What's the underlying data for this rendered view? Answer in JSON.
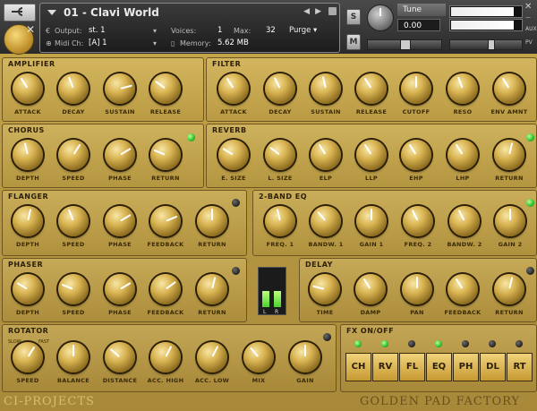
{
  "header": {
    "instrument_name": "01 - Clavi World",
    "output_label": "Output:",
    "output_value": "st. 1",
    "voices_label": "Voices:",
    "voices_value": "1",
    "max_label": "Max:",
    "max_value": "32",
    "purge_label": "Purge",
    "midi_label": "Midi Ch:",
    "midi_value": "[A]  1",
    "memory_label": "Memory:",
    "memory_value": "5.62 MB",
    "solo_label": "S",
    "mute_label": "M",
    "tune_label": "Tune",
    "tune_value": "0.00",
    "aux_label": "AUX",
    "pv_label": "PV",
    "level_fraction": 0.9,
    "pan_center": 0.5,
    "volume_fraction": 0.55
  },
  "sections": {
    "amplifier": {
      "title": "AMPLIFIER",
      "knobs": [
        {
          "label": "ATTACK",
          "value": 0.38
        },
        {
          "label": "DECAY",
          "value": 0.42
        },
        {
          "label": "SUSTAIN",
          "value": 0.78
        },
        {
          "label": "RELEASE",
          "value": 0.3
        }
      ]
    },
    "filter": {
      "title": "FILTER",
      "knobs": [
        {
          "label": "ATTACK",
          "value": 0.38
        },
        {
          "label": "DECAY",
          "value": 0.4
        },
        {
          "label": "SUSTAIN",
          "value": 0.45
        },
        {
          "label": "RELEASE",
          "value": 0.38
        },
        {
          "label": "CUTOFF",
          "value": 0.5
        },
        {
          "label": "RESO",
          "value": 0.42
        },
        {
          "label": "ENV AMNT",
          "value": 0.38
        }
      ]
    },
    "chorus": {
      "title": "CHORUS",
      "knobs": [
        {
          "label": "DEPTH",
          "value": 0.45
        },
        {
          "label": "SPEED",
          "value": 0.62
        },
        {
          "label": "PHASE",
          "value": 0.72
        },
        {
          "label": "RETURN",
          "value": 0.25
        }
      ]
    },
    "reverb": {
      "title": "REVERB",
      "knobs": [
        {
          "label": "E. SIZE",
          "value": 0.28
        },
        {
          "label": "L. SIZE",
          "value": 0.3
        },
        {
          "label": "ELP",
          "value": 0.38
        },
        {
          "label": "LLP",
          "value": 0.38
        },
        {
          "label": "EHP",
          "value": 0.38
        },
        {
          "label": "LHP",
          "value": 0.38
        },
        {
          "label": "RETURN",
          "value": 0.55
        }
      ]
    },
    "flanger": {
      "title": "FLANGER",
      "knobs": [
        {
          "label": "DEPTH",
          "value": 0.55
        },
        {
          "label": "SPEED",
          "value": 0.42
        },
        {
          "label": "PHASE",
          "value": 0.72
        },
        {
          "label": "FEEDBACK",
          "value": 0.75
        },
        {
          "label": "RETURN",
          "value": 0.5
        }
      ]
    },
    "eq": {
      "title": "2-BAND EQ",
      "knobs": [
        {
          "label": "FREQ. 1",
          "value": 0.45
        },
        {
          "label": "BANDW. 1",
          "value": 0.35
        },
        {
          "label": "GAIN 1",
          "value": 0.5
        },
        {
          "label": "FREQ. 2",
          "value": 0.4
        },
        {
          "label": "BANDW. 2",
          "value": 0.4
        },
        {
          "label": "GAIN 2",
          "value": 0.5
        }
      ]
    },
    "phaser": {
      "title": "PHASER",
      "knobs": [
        {
          "label": "DEPTH",
          "value": 0.28
        },
        {
          "label": "SPEED",
          "value": 0.25
        },
        {
          "label": "PHASE",
          "value": 0.72
        },
        {
          "label": "FEEDBACK",
          "value": 0.7
        },
        {
          "label": "RETURN",
          "value": 0.55
        }
      ]
    },
    "delay": {
      "title": "DELAY",
      "knobs": [
        {
          "label": "TIME",
          "value": 0.22
        },
        {
          "label": "DAMP",
          "value": 0.38
        },
        {
          "label": "PAN",
          "value": 0.5
        },
        {
          "label": "FEEDBACK",
          "value": 0.38
        },
        {
          "label": "RETURN",
          "value": 0.55
        }
      ]
    },
    "rotator": {
      "title": "ROTATOR",
      "slow_label": "SLOW",
      "fast_label": "FAST",
      "knobs": [
        {
          "label": "SPEED",
          "value": 0.62
        },
        {
          "label": "BALANCE",
          "value": 0.5
        },
        {
          "label": "DISTANCE",
          "value": 0.32
        },
        {
          "label": "ACC. HIGH",
          "value": 0.6
        },
        {
          "label": "ACC. LOW",
          "value": 0.6
        },
        {
          "label": "MIX",
          "value": 0.35
        },
        {
          "label": "GAIN",
          "value": 0.5
        }
      ]
    }
  },
  "fx_onoff": {
    "title": "FX ON/OFF",
    "buttons": [
      {
        "label": "CH",
        "on": true
      },
      {
        "label": "RV",
        "on": true
      },
      {
        "label": "FL",
        "on": false
      },
      {
        "label": "EQ",
        "on": true
      },
      {
        "label": "PH",
        "on": false
      },
      {
        "label": "DL",
        "on": false
      },
      {
        "label": "RT",
        "on": false
      }
    ]
  },
  "vu": {
    "left_label": "L",
    "right_label": "R",
    "left_level": 0.42,
    "right_level": 0.42
  },
  "footer": {
    "left": "CI-PROJECTS",
    "right": "GOLDEN PAD FACTORY"
  },
  "colors": {
    "gold": "#c9a94c",
    "led_on": "#2cc12a",
    "header": "#2a2a2a"
  }
}
